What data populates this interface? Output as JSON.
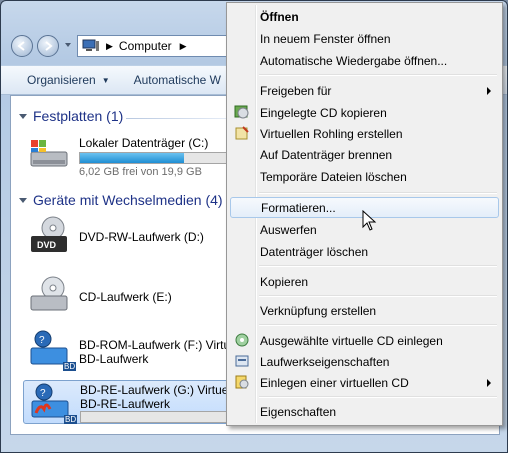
{
  "address": {
    "location": "Computer"
  },
  "toolbar": {
    "organize": "Organisieren",
    "autoplay": "Automatische W"
  },
  "groups": [
    {
      "title": "Festplatten (1)"
    },
    {
      "title": "Geräte mit Wechselmedien (4)"
    }
  ],
  "drives": [
    {
      "name": "Lokaler Datenträger (C:)",
      "size": "6,02 GB frei von 19,9 GB",
      "used_fraction": 0.7
    },
    {
      "name": "DVD-RW-Laufwerk (D:)",
      "label": "DVD"
    },
    {
      "name": "CD-Laufwerk (E:)"
    },
    {
      "name": "BD-ROM-Laufwerk (F:) Virtu",
      "sub": "BD-Laufwerk",
      "label": "BD"
    },
    {
      "name": "BD-RE-Laufwerk (G:) Virtuell",
      "sub": "BD-RE-Laufwerk",
      "label": "BD"
    }
  ],
  "menu": {
    "items": [
      {
        "label": "Öffnen",
        "bold": true
      },
      {
        "label": "In neuem Fenster öffnen"
      },
      {
        "label": "Automatische Wiedergabe öffnen..."
      },
      {
        "label": "Freigeben für",
        "submenu": true
      },
      {
        "label": "Eingelegte CD kopieren",
        "icon": "copy-cd-icon"
      },
      {
        "label": "Virtuellen Rohling erstellen",
        "icon": "blank-disc-icon"
      },
      {
        "label": "Auf Datenträger brennen"
      },
      {
        "label": "Temporäre Dateien löschen"
      },
      {
        "label": "Formatieren..."
      },
      {
        "label": "Auswerfen"
      },
      {
        "label": "Datenträger löschen"
      },
      {
        "label": "Kopieren"
      },
      {
        "label": "Verknüpfung erstellen"
      },
      {
        "label": "Ausgewählte virtuelle CD einlegen",
        "icon": "insert-cd-icon"
      },
      {
        "label": "Laufwerkseigenschaften",
        "icon": "drive-properties-icon"
      },
      {
        "label": "Einlegen einer virtuellen CD",
        "icon": "virtual-cd-icon",
        "submenu": true
      },
      {
        "label": "Eigenschaften"
      }
    ]
  },
  "colors": {
    "highlight": "#dce9f7",
    "group_title": "#1e3287",
    "bar_fill": "#26a0da"
  }
}
